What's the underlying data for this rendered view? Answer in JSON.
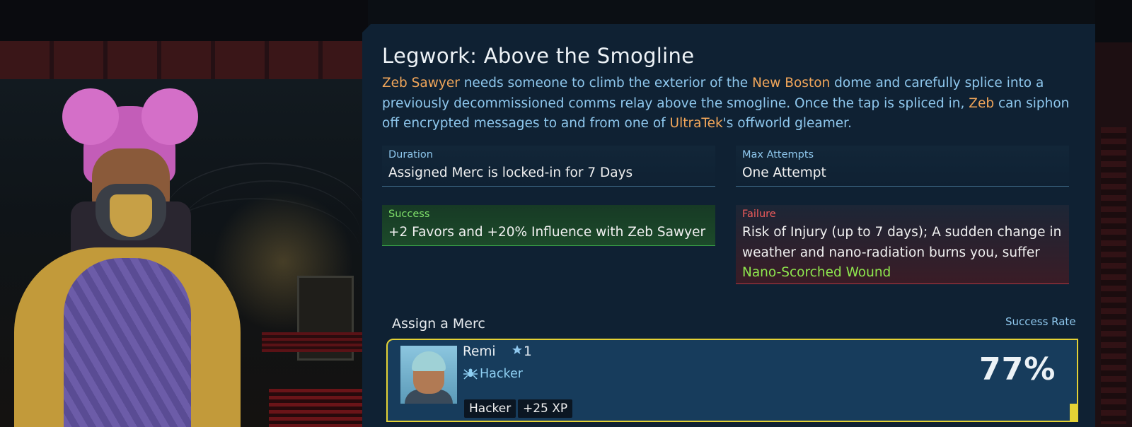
{
  "mission": {
    "title": "Legwork: Above the Smogline",
    "description": {
      "p1_name": "Zeb Sawyer",
      "p1_text": " needs someone to climb the exterior of the ",
      "p1_place": "New Boston",
      "p1_text2": " dome and carefully splice into a previously decommissioned comms relay above the smogline. Once the tap is spliced in, ",
      "p1_name2": "Zeb",
      "p1_text3": " can siphon off encrypted messages to and from one of ",
      "p1_corp": "UltraTek",
      "p1_text4": "'s offworld gleamer."
    }
  },
  "details": {
    "duration_label": "Duration",
    "duration_value": "Assigned Merc is locked-in for 7 Days",
    "attempts_label": "Max Attempts",
    "attempts_value": "One Attempt",
    "success_label": "Success",
    "success_value": "+2 Favors and +20% Influence with Zeb Sawyer",
    "failure_label": "Failure",
    "failure_text": "Risk of Injury (up to 7 days); A sudden change in weather and nano-radiation burns you, suffer ",
    "failure_wound": "Nano-Scorched Wound"
  },
  "assign": {
    "label": "Assign a Merc",
    "rate_label": "Success Rate",
    "merc": {
      "name": "Remi",
      "rank": "1",
      "rank_icon": "rank-star-icon",
      "class_icon": "spider-icon",
      "class": "Hacker",
      "tags": [
        "Hacker",
        "+25 XP"
      ],
      "success_rate": "77%"
    }
  },
  "colors": {
    "panel_bg": "#0f2133",
    "highlight": "#f1a65a",
    "text_blue": "#8fc8ee",
    "success_green": "#7fe06a",
    "failure_red": "#ef5b5b",
    "selected_border": "#e4d235"
  }
}
